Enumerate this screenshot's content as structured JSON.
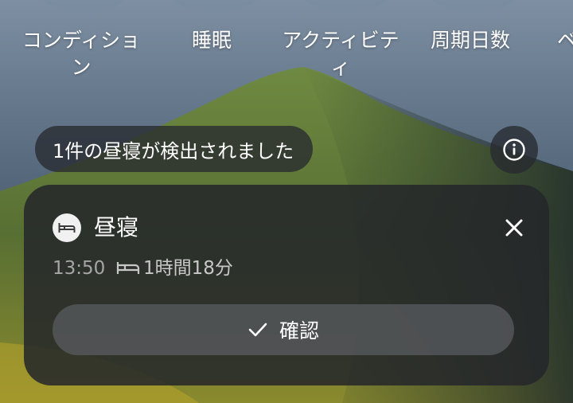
{
  "tabs": [
    {
      "line1": "コンディショ",
      "line2": "ン"
    },
    {
      "line1": "睡眠",
      "line2": ""
    },
    {
      "line1": "アクティビテ",
      "line2": "ィ"
    },
    {
      "line1": "周期日数",
      "line2": ""
    },
    {
      "line1": "ベ",
      "line2": ""
    }
  ],
  "banner": {
    "text": "1件の昼寝が検出されました",
    "info_icon": "info-icon"
  },
  "nap_card": {
    "title": "昼寝",
    "time": "13:50",
    "duration": "1時間18分",
    "confirm_label": "確認",
    "icons": {
      "bed": "bed-icon",
      "close": "close-icon",
      "check": "check-icon"
    }
  }
}
